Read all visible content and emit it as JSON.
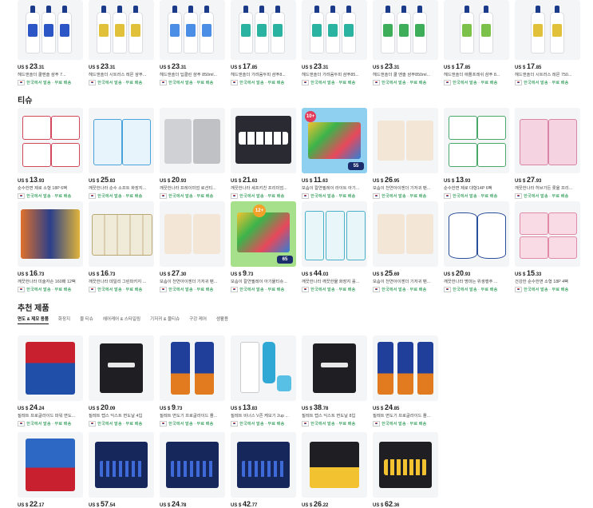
{
  "ship_label": "한국에서 발송 · 무료 배송",
  "row1": [
    {
      "cur": "US $",
      "num": "23",
      "cents": ".31",
      "title": "헤드앤숄더 쿨멘솔 샴푸 7..."
    },
    {
      "cur": "US $",
      "num": "23",
      "cents": ".31",
      "title": "헤드앤숄더 시트러스 레몬 샴푸..."
    },
    {
      "cur": "US $",
      "num": "23",
      "cents": ".31",
      "title": "헤드앤숄더 딥클린 샴푸 850ml..."
    },
    {
      "cur": "US $",
      "num": "17",
      "cents": ".85",
      "title": "헤드앤숄더 가려움두피 샴푸8..."
    },
    {
      "cur": "US $",
      "num": "23",
      "cents": ".31",
      "title": "헤드앤숄더 가려움두피 샴푸85..."
    },
    {
      "cur": "US $",
      "num": "23",
      "cents": ".31",
      "title": "헤드앤숄더 쿨 멘솔 샴푸850ml..."
    },
    {
      "cur": "US $",
      "num": "17",
      "cents": ".85",
      "title": "헤드앤숄더 애플프레쉬 샴푸 8..."
    },
    {
      "cur": "US $",
      "num": "17",
      "cents": ".85",
      "title": "헤드앤숄더 시트러스 레몬 750..."
    }
  ],
  "tissue_title": "티슈",
  "row2": [
    {
      "cur": "US $",
      "num": "13",
      "cents": ".93",
      "title": "순수한면 제로 소형 18P 6팩"
    },
    {
      "cur": "US $",
      "num": "25",
      "cents": ".83",
      "title": "깨끗한나라 순수 소프트 화장지..."
    },
    {
      "cur": "US $",
      "num": "20",
      "cents": ".93",
      "title": "깨끗한나라 프레이미엄 로션티..."
    },
    {
      "cur": "US $",
      "num": "21",
      "cents": ".63",
      "title": "깨끗한나라 세프키친 프리미엄..."
    },
    {
      "cur": "US $",
      "num": "11",
      "cents": ".63",
      "title": "보솜이 칼연필레이 라이트 아기..."
    },
    {
      "cur": "US $",
      "num": "26",
      "cents": ".95",
      "title": "보솜이 천연아이젠더 기저귀 팬..."
    },
    {
      "cur": "US $",
      "num": "13",
      "cents": ".93",
      "title": "순수한면 제로 대형14P 6팩"
    },
    {
      "cur": "US $",
      "num": "27",
      "cents": ".93",
      "title": "깨끗한나라 허브가든 롯울 프리..."
    }
  ],
  "row3": [
    {
      "cur": "US $",
      "num": "16",
      "cents": ".73",
      "title": "깨끗한나라 미술자손 160매 12팩"
    },
    {
      "cur": "US $",
      "num": "16",
      "cents": ".73",
      "title": "깨끗한나라 데일리 그린파키지 ..."
    },
    {
      "cur": "US $",
      "num": "27",
      "cents": ".30",
      "title": "보솜이 천연아이젠더 기저귀 팬..."
    },
    {
      "cur": "US $",
      "num": "9",
      "cents": ".73",
      "title": "보솜이 칼연필레이 아기물티슈..."
    },
    {
      "cur": "US $",
      "num": "44",
      "cents": ".03",
      "title": "깨끗한나라 깨끗한물 화장지 롤..."
    },
    {
      "cur": "US $",
      "num": "25",
      "cents": ".69",
      "title": "보솜이 천연아이젠더 기저귀 팬..."
    },
    {
      "cur": "US $",
      "num": "20",
      "cents": ".93",
      "title": "깨끗한나라 명마는 위생행주 ..."
    },
    {
      "cur": "US $",
      "num": "15",
      "cents": ".33",
      "title": "건강한 순수한면 소형 18P 4팩"
    }
  ],
  "badges": {
    "ten": "10+",
    "fiftyfive": "55",
    "twelve": "12+",
    "sixtyfive": "65"
  },
  "recommend_title": "추천 제품",
  "tabs": [
    "면도 & 제모 용품",
    "화장지",
    "물 티슈",
    "헤어케어 & 스타일링",
    "기저귀 & 물티슈",
    "구강 케어",
    "생활용"
  ],
  "row4": [
    {
      "cur": "US $",
      "num": "24",
      "cents": ".24",
      "title": "질레트 프로글라이드 파워 면도..."
    },
    {
      "cur": "US $",
      "num": "20",
      "cents": ".09",
      "title": "질레트 랩스 익스트 면도날 4입"
    },
    {
      "cur": "US $",
      "num": "9",
      "cents": ".73",
      "title": "질레트 면도기 프로글라이드 플..."
    },
    {
      "cur": "US $",
      "num": "13",
      "cents": ".83",
      "title": "질레트 비너스 V존 케모기 2up ..."
    },
    {
      "cur": "US $",
      "num": "38",
      "cents": ".78",
      "title": "질레트 랩스 익스트 면도날 8입"
    },
    {
      "cur": "US $",
      "num": "24",
      "cents": ".85",
      "title": "질레트 면도기 프로글라이드 플..."
    }
  ],
  "row5": [
    {
      "cur": "US $",
      "num": "22",
      "cents": ".17"
    },
    {
      "cur": "US $",
      "num": "57",
      "cents": ".54"
    },
    {
      "cur": "US $",
      "num": "24",
      "cents": ".78"
    },
    {
      "cur": "US $",
      "num": "42",
      "cents": ".77"
    },
    {
      "cur": "US $",
      "num": "26",
      "cents": ".22"
    },
    {
      "cur": "US $",
      "num": "62",
      "cents": ".36"
    }
  ]
}
